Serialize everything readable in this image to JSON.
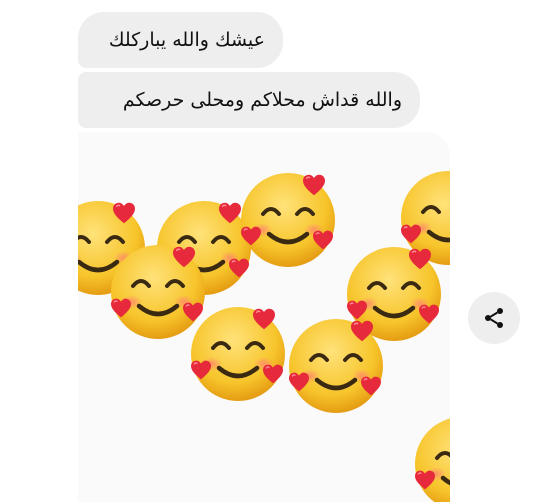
{
  "chat": {
    "messages": [
      {
        "text": "عيشك والله يباركلك"
      },
      {
        "text": "والله قداش محلاكم ومحلى حرصكم"
      }
    ],
    "sticker": {
      "icon": "smiling-face-with-hearts-emoji"
    },
    "share_icon": "share-icon"
  },
  "colors": {
    "bubble": "#eeeeee",
    "emoji_face": "#f7c52b",
    "heart": "#e6293b"
  }
}
